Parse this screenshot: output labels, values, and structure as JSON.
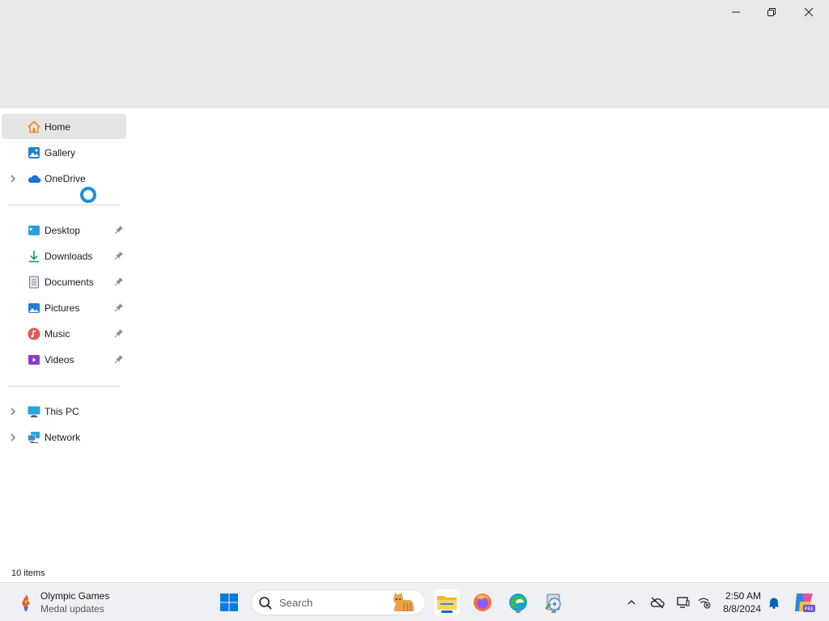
{
  "window": {
    "controls": {
      "minimize": "minimize-icon",
      "maximize": "restore-icon",
      "close": "close-icon"
    }
  },
  "sidebar": {
    "items": [
      {
        "label": "Home",
        "icon": "home-icon",
        "selected": true,
        "expandable": false,
        "pinned": false
      },
      {
        "label": "Gallery",
        "icon": "gallery-icon",
        "selected": false,
        "expandable": false,
        "pinned": false
      },
      {
        "label": "OneDrive",
        "icon": "onedrive-icon",
        "selected": false,
        "expandable": true,
        "pinned": false
      },
      {
        "label": "Desktop",
        "icon": "desktop-folder-icon",
        "selected": false,
        "expandable": false,
        "pinned": true
      },
      {
        "label": "Downloads",
        "icon": "downloads-icon",
        "selected": false,
        "expandable": false,
        "pinned": true
      },
      {
        "label": "Documents",
        "icon": "documents-icon",
        "selected": false,
        "expandable": false,
        "pinned": true
      },
      {
        "label": "Pictures",
        "icon": "pictures-icon",
        "selected": false,
        "expandable": false,
        "pinned": true
      },
      {
        "label": "Music",
        "icon": "music-icon",
        "selected": false,
        "expandable": false,
        "pinned": true
      },
      {
        "label": "Videos",
        "icon": "videos-icon",
        "selected": false,
        "expandable": false,
        "pinned": true
      },
      {
        "label": "This PC",
        "icon": "this-pc-icon",
        "selected": false,
        "expandable": true,
        "pinned": false
      },
      {
        "label": "Network",
        "icon": "network-icon",
        "selected": false,
        "expandable": true,
        "pinned": false
      }
    ]
  },
  "status": {
    "item_count": "10 items"
  },
  "taskbar": {
    "widget": {
      "title": "Olympic Games",
      "subtitle": "Medal updates",
      "icon": "olympic-torch-icon"
    },
    "search": {
      "placeholder": "Search",
      "icon": "search-icon"
    },
    "apps": [
      {
        "name": "start-button",
        "icon": "windows-logo-icon"
      },
      {
        "name": "file-explorer",
        "icon": "file-explorer-icon",
        "active": true
      },
      {
        "name": "firefox",
        "icon": "firefox-icon"
      },
      {
        "name": "edge",
        "icon": "edge-icon",
        "running": true
      },
      {
        "name": "setup",
        "icon": "setup-disc-icon",
        "running": true
      }
    ],
    "tray": {
      "time": "2:50 AM",
      "date": "8/8/2024"
    }
  },
  "colors": {
    "accent": "#0067c0",
    "titlebar_bg": "#e9e9e9",
    "selected_bg": "#e5e5e5",
    "taskbar_bg": "#eef0f3"
  }
}
